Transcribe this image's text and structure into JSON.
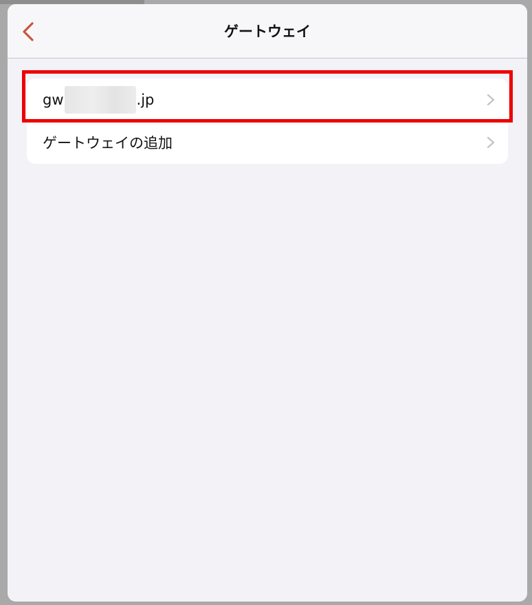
{
  "nav": {
    "title": "ゲートウェイ",
    "back_icon": "chevron-left-icon",
    "accent": "#c8553d"
  },
  "list": {
    "items": [
      {
        "prefix": "gw",
        "suffix": ".jp",
        "redacted": true,
        "icon": "chevron-right-icon"
      },
      {
        "label": "ゲートウェイの追加",
        "icon": "chevron-right-icon"
      }
    ]
  },
  "highlight_color": "#ee0000"
}
